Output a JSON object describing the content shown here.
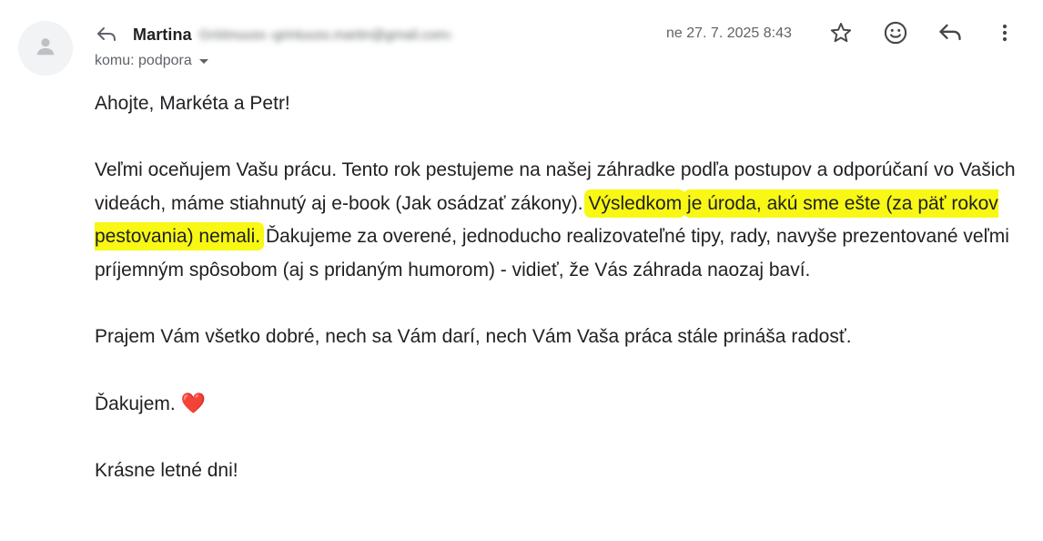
{
  "sender": {
    "name": "Martina",
    "email_obscured": "Gröönuuss ‹grintuuss.martin@gmail.com›"
  },
  "date": "ne 27. 7. 2025 8:43",
  "recipient_label": "komu: podpora",
  "icons": {
    "avatar": "person-icon",
    "reply_small": "reply-arrow-icon",
    "star": "star-icon",
    "emoji": "emoji-icon",
    "reply": "reply-icon",
    "more": "more-vert-icon"
  },
  "body": {
    "greeting": "Ahojte, Markéta a Petr!",
    "p1_a": "Veľmi oceňujem Vašu prácu. Tento rok pestujeme na našej záhradke podľa postupov a odporúčaní vo Vašich videách, máme stiahnutý aj e-book (Jak osádzať zákony).",
    "p1_highlight_1": "Výsledkom",
    "p1_highlight_2": "je úroda, akú sme ešte (za päť rokov pestovania) nemali.",
    "p1_b": "Ďakujeme za overené, jednoducho realizovateľné tipy, rady, navyše prezentované veľmi príjemným spôsobom (aj s pridaným humorom) - vidieť, že Vás záhrada naozaj baví.",
    "p2": "Prajem Vám všetko dobré, nech sa Vám darí, nech Vám Vaša práca stále prináša radosť.",
    "p3_text": "Ďakujem.",
    "p3_emoji": "❤️",
    "p4": "Krásne letné dni!"
  },
  "colors": {
    "highlight": "#f8f814",
    "text": "#202124",
    "muted": "#5f6368",
    "heart": "#e0263a"
  }
}
